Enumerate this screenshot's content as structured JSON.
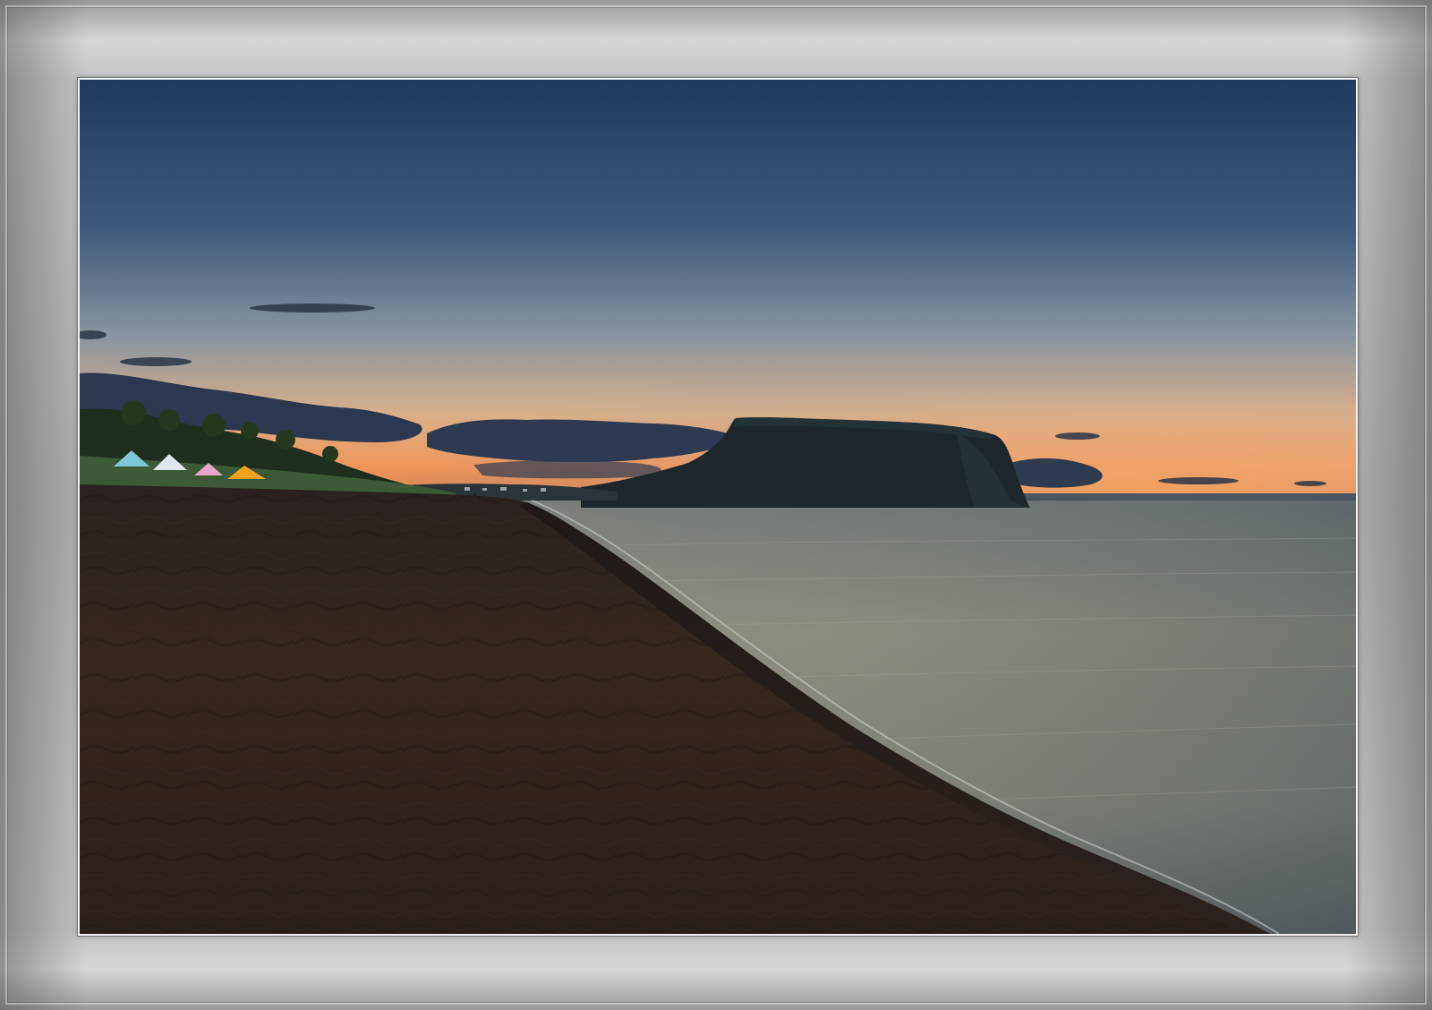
{
  "scene": {
    "subject": "beach-sunset-with-headland",
    "colors": {
      "sky_top": "#1f3b5e",
      "sky_mid": "#4d6584",
      "sky_low": "#9aa1a8",
      "horizon_glow": "#f0a060",
      "horizon_orange": "#e88a4a",
      "sea": "#8e8f86",
      "sea_dark": "#55605f",
      "sand": "#2e2320",
      "sand_dark": "#1f1816",
      "headland": "#1f2a2f",
      "grass": "#2f4a2c",
      "tent_blue": "#7fc7d8",
      "tent_white": "#dfe6ec",
      "tent_pink": "#e7a6c9",
      "tent_orange": "#f2a21c",
      "frame": "#b8b8b8"
    },
    "icons": [
      "tent-icon",
      "headland-icon",
      "cloud-icon"
    ]
  }
}
